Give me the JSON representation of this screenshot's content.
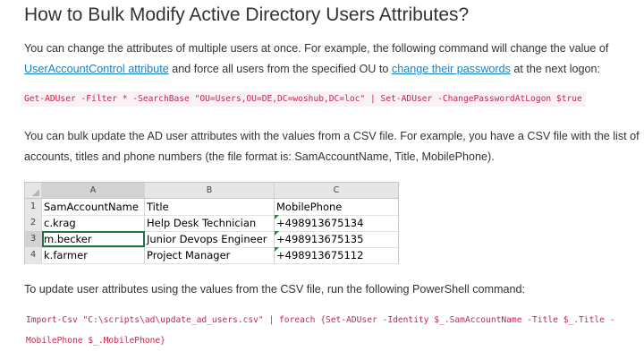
{
  "article": {
    "heading": "How to Bulk Modify Active Directory Users Attributes?",
    "para1": {
      "text_a": "You can change the attributes of multiple users at once. For example, the following command will change the value of ",
      "link1": "UserAccountControl attribute",
      "text_b": " and force all users from the specified OU to ",
      "link2": "change their passwords",
      "text_c": " at the next logon:"
    },
    "code1": "Get-ADUser -Filter * -SearchBase \"OU=Users,OU=DE,DC=woshub,DC=loc\" | Set-ADUser -ChangePasswordAtLogon $true",
    "para2": "You can bulk update the AD user attributes with the values from a CSV file. For example, you have a CSV file with the list of accounts, titles and phone numbers (the file format is: SamAccountName, Title, MobilePhone).",
    "para3": "To update user attributes using the values from the CSV file, run the following PowerShell command:",
    "code2": "Import-Csv \"C:\\scripts\\ad\\update_ad_users.csv\" | foreach {Set-ADUser -Identity $_.SamAccountName -Title $_.Title -MobilePhone $_.MobilePhone}"
  },
  "spreadsheet": {
    "columns": [
      "A",
      "B",
      "C"
    ],
    "rows": [
      {
        "num": "1",
        "cells": [
          "SamAccountName",
          "Title",
          "MobilePhone"
        ]
      },
      {
        "num": "2",
        "cells": [
          "c.krag",
          "Help Desk Technician",
          "+498913675134"
        ]
      },
      {
        "num": "3",
        "cells": [
          "m.becker",
          "Junior Devops Engineer",
          "+498913675135"
        ]
      },
      {
        "num": "4",
        "cells": [
          "k.farmer",
          "Project Manager",
          "+498913675112"
        ]
      }
    ],
    "active_cell": "A3",
    "accent_color": "#217346"
  },
  "colors": {
    "link": "#1a82c4",
    "code_text": "#c7254e",
    "code_bg": "#f9f2f4",
    "body_text": "#333333"
  }
}
